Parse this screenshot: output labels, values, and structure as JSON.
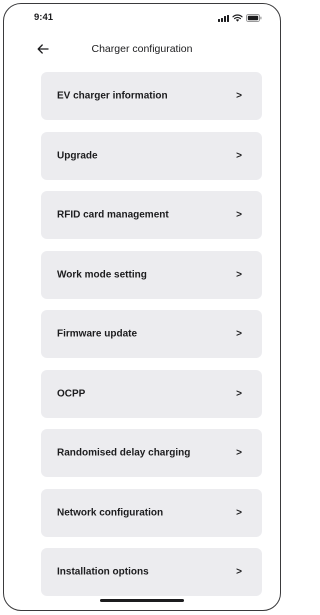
{
  "status_bar": {
    "time": "9:41",
    "icons": [
      "signal-icon",
      "wifi-icon",
      "battery-icon"
    ]
  },
  "header": {
    "back_icon": "arrow-left-icon",
    "title": "Charger configuration"
  },
  "menu": {
    "chevron": ">",
    "items": [
      {
        "label": "EV charger information"
      },
      {
        "label": "Upgrade"
      },
      {
        "label": "RFID card management"
      },
      {
        "label": "Work mode setting"
      },
      {
        "label": "Firmware update"
      },
      {
        "label": "OCPP"
      },
      {
        "label": "Randomised delay charging"
      },
      {
        "label": "Network configuration"
      },
      {
        "label": "Installation options"
      }
    ]
  },
  "colors": {
    "item_background": "#ececef",
    "text": "#1c1c1e",
    "frame": "#3a3a3c"
  }
}
